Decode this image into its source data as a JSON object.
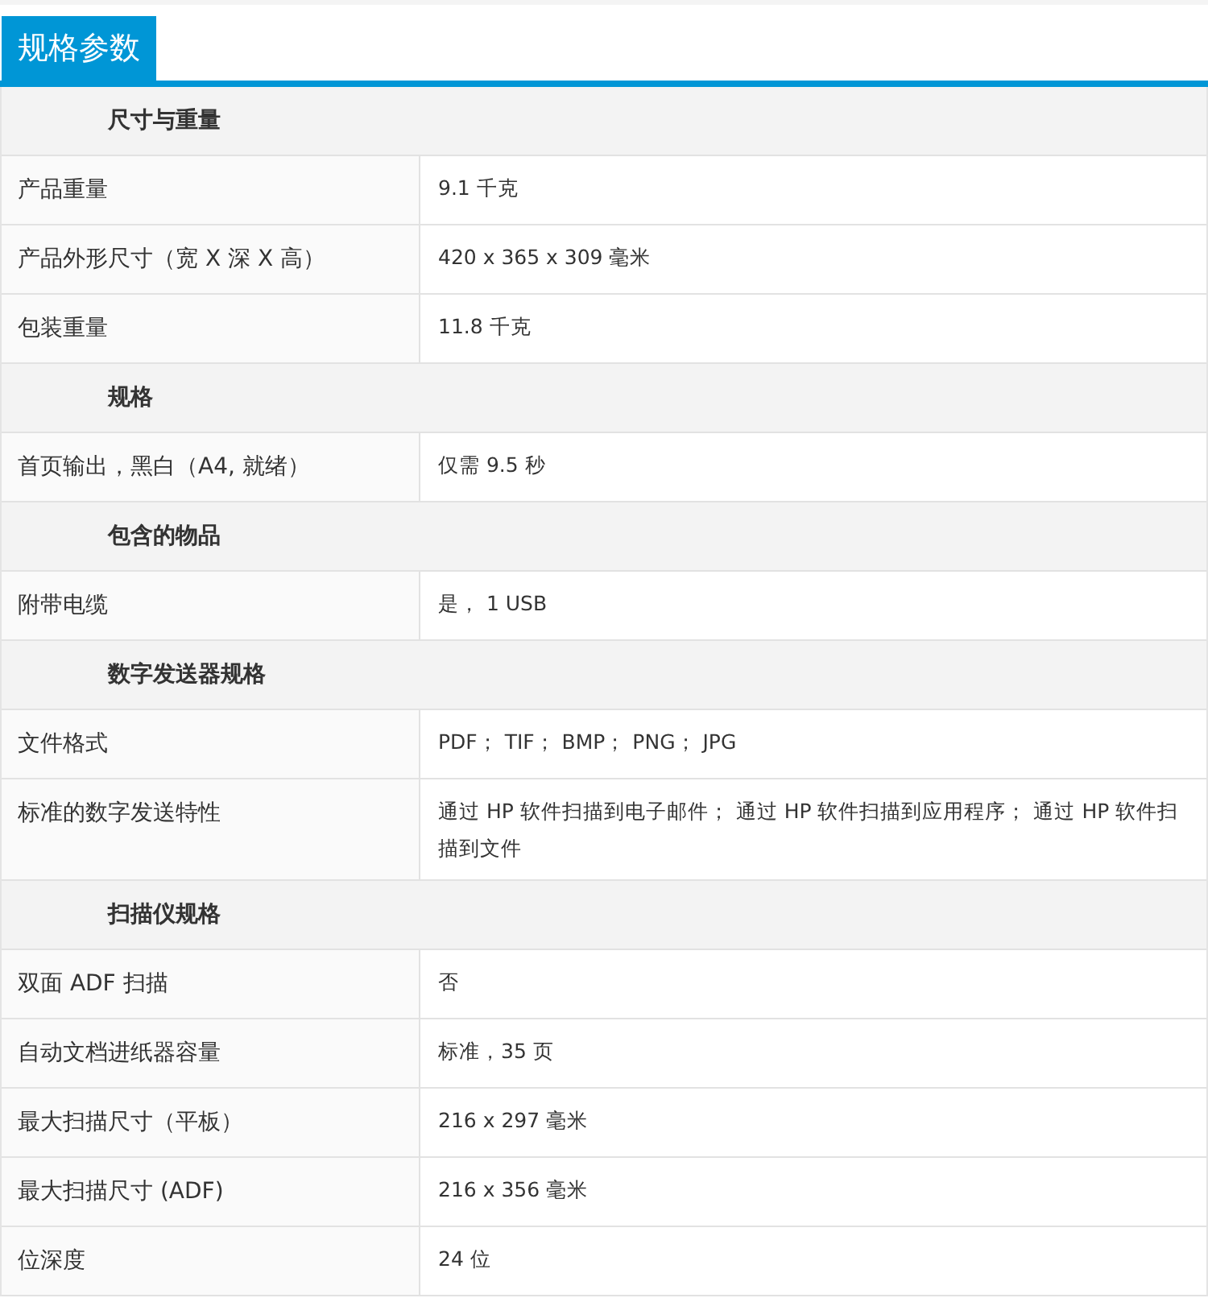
{
  "title_tab": {
    "label": "规格参数"
  },
  "sections": [
    {
      "heading": "尺寸与重量",
      "rows": [
        {
          "label": "产品重量",
          "value": "9.1 千克"
        },
        {
          "label": "产品外形尺寸（宽 X 深 X 高）",
          "value": "420 x 365 x 309 毫米"
        },
        {
          "label": "包装重量",
          "value": "11.8 千克"
        }
      ]
    },
    {
      "heading": "规格",
      "rows": [
        {
          "label": "首页输出，黑白（A4, 就绪）",
          "value": "仅需 9.5 秒"
        }
      ]
    },
    {
      "heading": "包含的物品",
      "rows": [
        {
          "label": "附带电缆",
          "value": "是， 1 USB"
        }
      ]
    },
    {
      "heading": "数字发送器规格",
      "rows": [
        {
          "label": "文件格式",
          "value": "PDF； TIF； BMP； PNG； JPG"
        },
        {
          "label": "标准的数字发送特性",
          "value": "通过 HP 软件扫描到电子邮件； 通过 HP 软件扫描到应用程序； 通过 HP 软件扫描到文件"
        }
      ]
    },
    {
      "heading": "扫描仪规格",
      "rows": [
        {
          "label": "双面 ADF 扫描",
          "value": "否"
        },
        {
          "label": "自动文档进纸器容量",
          "value": "标准，35 页"
        },
        {
          "label": "最大扫描尺寸（平板）",
          "value": "216 x 297 毫米"
        },
        {
          "label": "最大扫描尺寸 (ADF)",
          "value": "216 x 356 毫米"
        },
        {
          "label": "位深度",
          "value": "24 位"
        }
      ]
    }
  ]
}
